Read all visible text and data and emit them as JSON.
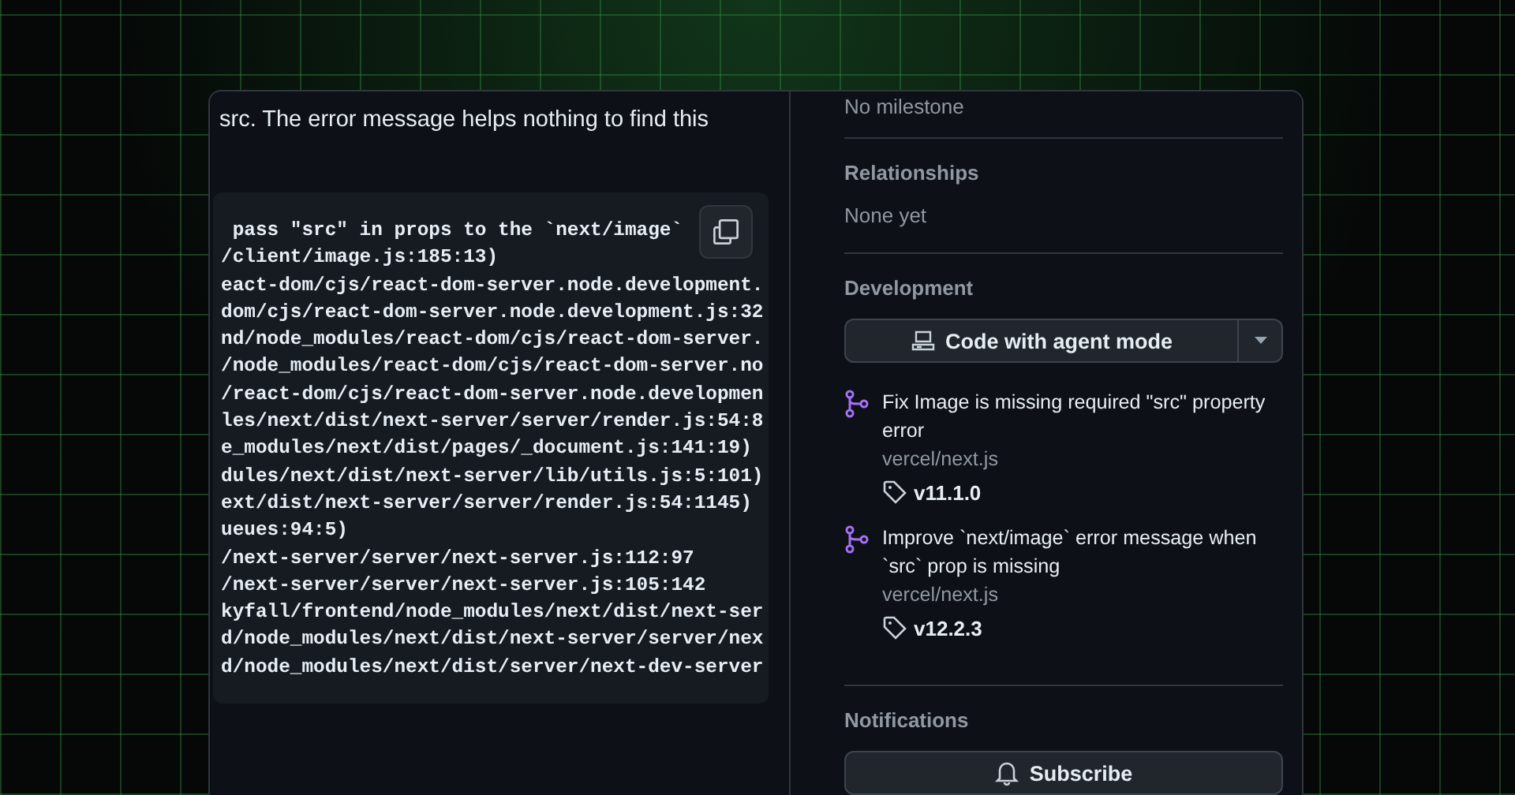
{
  "issue_body": {
    "text": "src. The error message helps nothing to find this",
    "code_lines": [
      " pass \"src\" in props to the `next/image`",
      "/client/image.js:185:13)",
      "eact-dom/cjs/react-dom-server.node.development.",
      "dom/cjs/react-dom-server.node.development.js:32",
      "nd/node_modules/react-dom/cjs/react-dom-server.",
      "/node_modules/react-dom/cjs/react-dom-server.no",
      "/react-dom/cjs/react-dom-server.node.developmen",
      "les/next/dist/next-server/server/render.js:54:8",
      "e_modules/next/dist/pages/_document.js:141:19)",
      "dules/next/dist/next-server/lib/utils.js:5:101)",
      "ext/dist/next-server/server/render.js:54:1145)",
      "ueues:94:5)",
      "/next-server/server/next-server.js:112:97",
      "/next-server/server/next-server.js:105:142",
      "kyfall/frontend/node_modules/next/dist/next-ser",
      "d/node_modules/next/dist/next-server/server/nex",
      "d/node_modules/next/dist/server/next-dev-server"
    ]
  },
  "sidebar": {
    "milestone": "No milestone",
    "relationships": {
      "heading": "Relationships",
      "value": "None yet"
    },
    "development": {
      "heading": "Development",
      "button": "Code with agent mode",
      "pull_requests": [
        {
          "title": "Fix Image is missing required \"src\" property error",
          "repo": "vercel/next.js",
          "tag": "v11.1.0"
        },
        {
          "title": "Improve `next/image` error message when `src` prop is missing",
          "repo": "vercel/next.js",
          "tag": "v12.2.3"
        }
      ]
    },
    "notifications": {
      "heading": "Notifications",
      "button": "Subscribe"
    }
  }
}
